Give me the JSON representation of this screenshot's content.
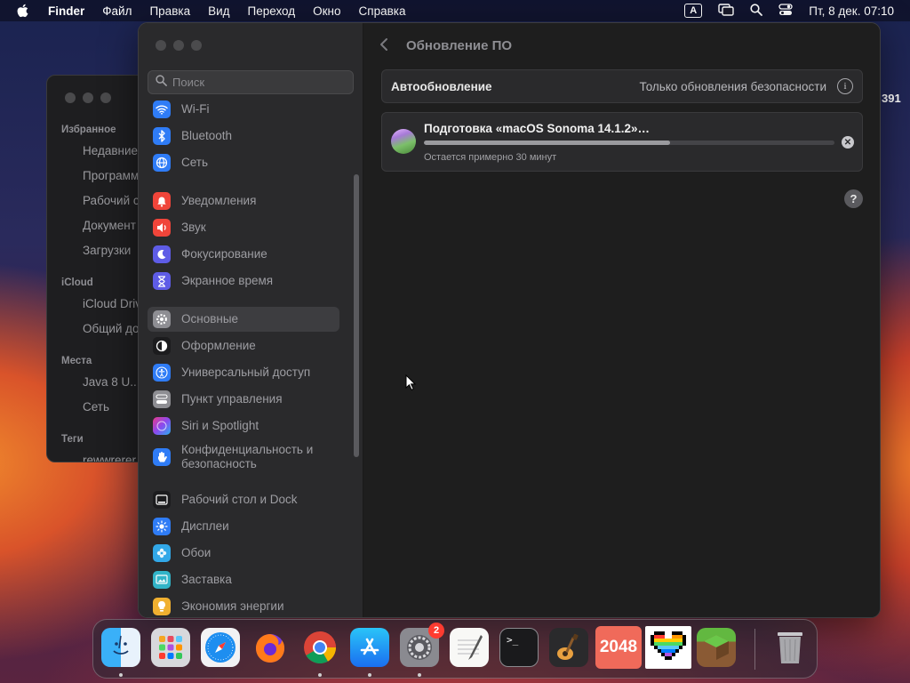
{
  "menubar": {
    "app": "Finder",
    "items": [
      "Файл",
      "Правка",
      "Вид",
      "Переход",
      "Окно",
      "Справка"
    ],
    "input_source": "A",
    "clock": "Пт, 8 дек.  07:10"
  },
  "finder_bg": {
    "favorites_header": "Избранное",
    "favorites": [
      "Недавние",
      "Программы",
      "Рабочий с",
      "Документ",
      "Загрузки"
    ],
    "icloud_header": "iCloud",
    "icloud": [
      "iCloud Drive",
      "Общий до"
    ],
    "places_header": "Места",
    "places": [
      "Java 8 U...",
      "Сеть"
    ],
    "tags_header": "Теги",
    "tags": [
      "rewwrerer"
    ]
  },
  "right_digits": "391",
  "settings": {
    "search_placeholder": "Поиск",
    "sidebar": [
      {
        "label": "Wi-Fi",
        "icon": "wifi-icon",
        "color": "#2f7cf6"
      },
      {
        "label": "Bluetooth",
        "icon": "bluetooth-icon",
        "color": "#2f7cf6"
      },
      {
        "label": "Сеть",
        "icon": "globe-icon",
        "color": "#2f7cf6"
      },
      {
        "label": "Уведомления",
        "icon": "bell-icon",
        "color": "#f0453a"
      },
      {
        "label": "Звук",
        "icon": "speaker-icon",
        "color": "#f0453a"
      },
      {
        "label": "Фокусирование",
        "icon": "moon-icon",
        "color": "#5e5ce6"
      },
      {
        "label": "Экранное время",
        "icon": "hourglass-icon",
        "color": "#5e5ce6"
      },
      {
        "label": "Основные",
        "icon": "gear-icon",
        "color": "#8e8e93"
      },
      {
        "label": "Оформление",
        "icon": "appearance-icon",
        "color": "#1c1c1e"
      },
      {
        "label": "Универсальный доступ",
        "icon": "accessibility-icon",
        "color": "#2f7cf6"
      },
      {
        "label": "Пункт управления",
        "icon": "control-center-icon",
        "color": "#8e8e93"
      },
      {
        "label": "Siri и Spotlight",
        "icon": "siri-icon",
        "color": "#c04ad8"
      },
      {
        "label": "Конфиденциальность и безопасность",
        "icon": "hand-icon",
        "color": "#2f7cf6"
      },
      {
        "label": "Рабочий стол и Dock",
        "icon": "dock-icon",
        "color": "#1c1c1e"
      },
      {
        "label": "Дисплеи",
        "icon": "sun-icon",
        "color": "#2f7cf6"
      },
      {
        "label": "Обои",
        "icon": "flower-icon",
        "color": "#32a8e8"
      },
      {
        "label": "Заставка",
        "icon": "screensaver-icon",
        "color": "#32b4c8"
      },
      {
        "label": "Экономия энергии",
        "icon": "bulb-icon",
        "color": "#f0b030"
      }
    ],
    "selected": "Основные",
    "page_title": "Обновление ПО",
    "auto_update": {
      "label": "Автообновление",
      "value": "Только обновления безопасности"
    },
    "update": {
      "title": "Подготовка «macOS Sonoma 14.1.2»…",
      "progress": 0.6,
      "status": "Остается примерно 30 минут"
    },
    "help": "?"
  },
  "dock": {
    "apps": [
      {
        "name": "Finder",
        "icon": "finder-icon",
        "running": true
      },
      {
        "name": "Launchpad",
        "icon": "launchpad-icon",
        "running": false
      },
      {
        "name": "Safari",
        "icon": "safari-icon",
        "running": false
      },
      {
        "name": "Firefox",
        "icon": "firefox-icon",
        "running": false
      },
      {
        "name": "Chrome",
        "icon": "chrome-icon",
        "running": true
      },
      {
        "name": "App Store",
        "icon": "app-store-icon",
        "running": true
      },
      {
        "name": "Системные настройки",
        "icon": "system-settings-icon",
        "running": true,
        "badge": "2"
      },
      {
        "name": "TextEdit",
        "icon": "textedit-icon",
        "running": false
      },
      {
        "name": "Терминал",
        "icon": "terminal-icon",
        "running": false
      },
      {
        "name": "GarageBand",
        "icon": "garageband-icon",
        "running": false
      },
      {
        "name": "2048",
        "icon": "2048-icon",
        "running": false,
        "text": "2048"
      },
      {
        "name": "Pixel Heart",
        "icon": "pixel-heart-icon",
        "running": false
      },
      {
        "name": "Minecraft",
        "icon": "minecraft-icon",
        "running": false
      },
      {
        "name": "Корзина",
        "icon": "trash-icon",
        "running": false
      }
    ]
  }
}
